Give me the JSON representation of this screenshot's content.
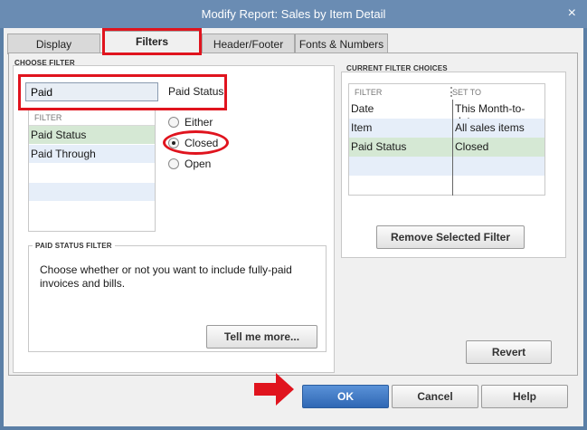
{
  "window": {
    "title": "Modify Report: Sales by Item Detail",
    "close_glyph": "×"
  },
  "tabs": [
    {
      "label": "Display",
      "active": false
    },
    {
      "label": "Filters",
      "active": true
    },
    {
      "label": "Header/Footer",
      "active": false
    },
    {
      "label": "Fonts & Numbers",
      "active": false
    }
  ],
  "choose_filter": {
    "section_label": "CHOOSE FILTER",
    "search_value": "Paid",
    "selected_filter_label": "Paid Status",
    "list_header": "FILTER",
    "items": [
      "Paid Status",
      "Paid Through"
    ],
    "radio_options": [
      {
        "label": "Either",
        "selected": false
      },
      {
        "label": "Closed",
        "selected": true
      },
      {
        "label": "Open",
        "selected": false
      }
    ]
  },
  "paid_status_filter": {
    "section_label": "PAID STATUS FILTER",
    "description": "Choose whether or not you want to include fully-paid invoices and bills.",
    "tell_more_button": "Tell me more..."
  },
  "current_filters": {
    "section_label": "CURRENT FILTER CHOICES",
    "col_filter": "FILTER",
    "col_set_to": "SET TO",
    "rows": [
      {
        "filter": "Date",
        "set_to": "This Month-to-date"
      },
      {
        "filter": "Item",
        "set_to": "All sales items"
      },
      {
        "filter": "Paid Status",
        "set_to": "Closed"
      }
    ],
    "remove_button": "Remove Selected Filter",
    "revert_button": "Revert"
  },
  "footer": {
    "ok": "OK",
    "cancel": "Cancel",
    "help": "Help"
  },
  "colors": {
    "annotation_red": "#e0141e",
    "ok_blue": "#3f78c4",
    "titlebar": "#6a8cb3"
  }
}
